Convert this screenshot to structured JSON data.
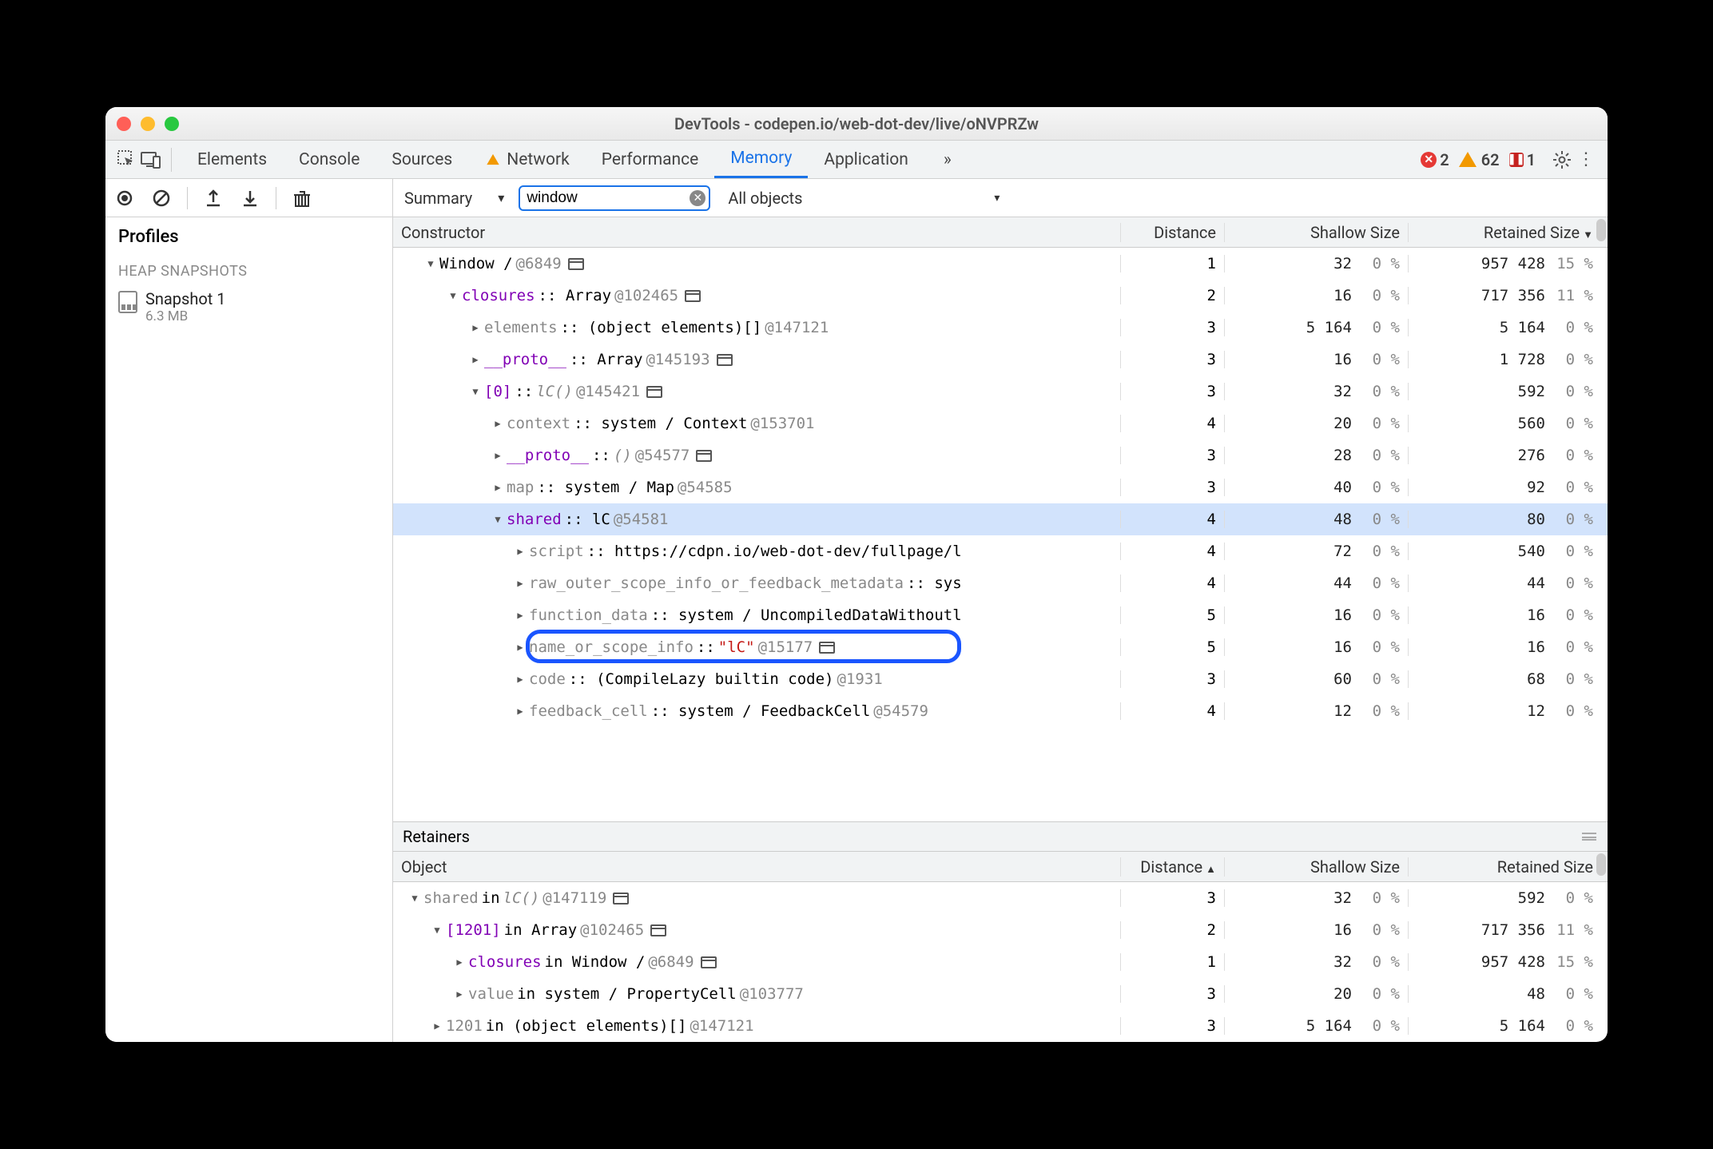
{
  "window": {
    "title": "DevTools - codepen.io/web-dot-dev/live/oNVPRZw"
  },
  "tabs": {
    "items": [
      "Elements",
      "Console",
      "Sources",
      "Network",
      "Performance",
      "Memory",
      "Application"
    ],
    "active": "Memory"
  },
  "status": {
    "errors": 2,
    "warnings": 62,
    "issues": 1
  },
  "subbar": {
    "view": "Summary",
    "filter": "window",
    "scope": "All objects"
  },
  "sidebar": {
    "title": "Profiles",
    "section": "HEAP SNAPSHOTS",
    "items": [
      {
        "name": "Snapshot 1",
        "size": "6.3 MB"
      }
    ]
  },
  "columns": {
    "constructor": "Constructor",
    "distance": "Distance",
    "shallow": "Shallow Size",
    "retained": "Retained Size"
  },
  "rows": [
    {
      "indent": 0,
      "tw": "▼",
      "parts": [
        [
          "",
          "Window / "
        ],
        [
          "grey",
          "   @6849 "
        ]
      ],
      "win": true,
      "d": "1",
      "sv": "32",
      "sp": "0 %",
      "rv": "957 428",
      "rp": "15 %"
    },
    {
      "indent": 1,
      "tw": "▼",
      "parts": [
        [
          "purple",
          "closures"
        ],
        [
          "",
          " :: Array "
        ],
        [
          "grey",
          "@102465 "
        ]
      ],
      "win": true,
      "d": "2",
      "sv": "16",
      "sp": "0 %",
      "rv": "717 356",
      "rp": "11 %"
    },
    {
      "indent": 2,
      "tw": "▶",
      "parts": [
        [
          "grey",
          "elements"
        ],
        [
          "",
          " :: (object elements)[] "
        ],
        [
          "grey",
          "@147121"
        ]
      ],
      "d": "3",
      "sv": "5 164",
      "sp": "0 %",
      "rv": "5 164",
      "rp": "0 %"
    },
    {
      "indent": 2,
      "tw": "▶",
      "parts": [
        [
          "purple",
          "__proto__"
        ],
        [
          "",
          " :: Array "
        ],
        [
          "grey",
          "@145193 "
        ]
      ],
      "win": true,
      "d": "3",
      "sv": "16",
      "sp": "0 %",
      "rv": "1 728",
      "rp": "0 %"
    },
    {
      "indent": 2,
      "tw": "▼",
      "parts": [
        [
          "purple",
          "[0]"
        ],
        [
          "",
          " :: "
        ],
        [
          "gitalic",
          "lC()"
        ],
        [
          "grey",
          " @145421 "
        ]
      ],
      "win": true,
      "d": "3",
      "sv": "32",
      "sp": "0 %",
      "rv": "592",
      "rp": "0 %"
    },
    {
      "indent": 3,
      "tw": "▶",
      "parts": [
        [
          "grey",
          "context"
        ],
        [
          "",
          " :: system / Context "
        ],
        [
          "grey",
          "@153701"
        ]
      ],
      "d": "4",
      "sv": "20",
      "sp": "0 %",
      "rv": "560",
      "rp": "0 %"
    },
    {
      "indent": 3,
      "tw": "▶",
      "parts": [
        [
          "purple",
          "__proto__"
        ],
        [
          "",
          " :: "
        ],
        [
          "gitalic",
          "()"
        ],
        [
          "grey",
          " @54577 "
        ]
      ],
      "win": true,
      "d": "3",
      "sv": "28",
      "sp": "0 %",
      "rv": "276",
      "rp": "0 %"
    },
    {
      "indent": 3,
      "tw": "▶",
      "parts": [
        [
          "grey",
          "map"
        ],
        [
          "",
          " :: system / Map "
        ],
        [
          "grey",
          "@54585"
        ]
      ],
      "d": "3",
      "sv": "40",
      "sp": "0 %",
      "rv": "92",
      "rp": "0 %"
    },
    {
      "indent": 3,
      "tw": "▼",
      "sel": true,
      "parts": [
        [
          "purple",
          "shared"
        ],
        [
          "",
          " :: lC "
        ],
        [
          "grey",
          "@54581"
        ]
      ],
      "d": "4",
      "sv": "48",
      "sp": "0 %",
      "rv": "80",
      "rp": "0 %"
    },
    {
      "indent": 4,
      "tw": "▶",
      "parts": [
        [
          "grey",
          "script"
        ],
        [
          "",
          " :: https://cdpn.io/web-dot-dev/fullpage/l"
        ]
      ],
      "d": "4",
      "sv": "72",
      "sp": "0 %",
      "rv": "540",
      "rp": "0 %"
    },
    {
      "indent": 4,
      "tw": "▶",
      "parts": [
        [
          "grey",
          "raw_outer_scope_info_or_feedback_metadata"
        ],
        [
          "",
          " :: sys"
        ]
      ],
      "d": "4",
      "sv": "44",
      "sp": "0 %",
      "rv": "44",
      "rp": "0 %"
    },
    {
      "indent": 4,
      "tw": "▶",
      "parts": [
        [
          "grey",
          "function_data"
        ],
        [
          "",
          " :: system / UncompiledDataWithoutl"
        ]
      ],
      "d": "5",
      "sv": "16",
      "sp": "0 %",
      "rv": "16",
      "rp": "0 %"
    },
    {
      "indent": 4,
      "tw": "▶",
      "ring": true,
      "parts": [
        [
          "grey",
          "name_or_scope_info"
        ],
        [
          "",
          " :: "
        ],
        [
          "red",
          "\"lC\""
        ],
        [
          "grey",
          " @15177 "
        ]
      ],
      "win": true,
      "d": "5",
      "sv": "16",
      "sp": "0 %",
      "rv": "16",
      "rp": "0 %"
    },
    {
      "indent": 4,
      "tw": "▶",
      "parts": [
        [
          "grey",
          "code"
        ],
        [
          "",
          " :: (CompileLazy builtin code) "
        ],
        [
          "grey",
          "@1931"
        ]
      ],
      "d": "3",
      "sv": "60",
      "sp": "0 %",
      "rv": "68",
      "rp": "0 %"
    },
    {
      "indent": 4,
      "tw": "▶",
      "parts": [
        [
          "grey",
          "feedback_cell"
        ],
        [
          "",
          " :: system / FeedbackCell "
        ],
        [
          "grey",
          "@54579"
        ]
      ],
      "d": "4",
      "sv": "12",
      "sp": "0 %",
      "rv": "12",
      "rp": "0 %"
    }
  ],
  "retainers": {
    "title": "Retainers",
    "columns": {
      "object": "Object",
      "distance": "Distance",
      "shallow": "Shallow Size",
      "retained": "Retained Size"
    },
    "rows": [
      {
        "indent": 0,
        "tw": "▼",
        "parts": [
          [
            "grey",
            "shared"
          ],
          [
            "",
            " in "
          ],
          [
            "gitalic",
            "lC()"
          ],
          [
            "grey",
            " @147119 "
          ]
        ],
        "win": true,
        "d": "3",
        "sv": "32",
        "sp": "0 %",
        "rv": "592",
        "rp": "0 %"
      },
      {
        "indent": 1,
        "tw": "▼",
        "parts": [
          [
            "purple",
            "[1201]"
          ],
          [
            "",
            " in Array "
          ],
          [
            "grey",
            "@102465 "
          ]
        ],
        "win": true,
        "d": "2",
        "sv": "16",
        "sp": "0 %",
        "rv": "717 356",
        "rp": "11 %"
      },
      {
        "indent": 2,
        "tw": "▶",
        "parts": [
          [
            "purple",
            "closures"
          ],
          [
            "",
            " in Window /   "
          ],
          [
            "grey",
            "@6849 "
          ]
        ],
        "win": true,
        "d": "1",
        "sv": "32",
        "sp": "0 %",
        "rv": "957 428",
        "rp": "15 %"
      },
      {
        "indent": 2,
        "tw": "▶",
        "parts": [
          [
            "grey",
            "value"
          ],
          [
            "",
            " in system / PropertyCell "
          ],
          [
            "grey",
            "@103777"
          ]
        ],
        "d": "3",
        "sv": "20",
        "sp": "0 %",
        "rv": "48",
        "rp": "0 %"
      },
      {
        "indent": 1,
        "tw": "▶",
        "parts": [
          [
            "grey",
            "1201"
          ],
          [
            "",
            " in (object elements)[] "
          ],
          [
            "grey",
            "@147121"
          ]
        ],
        "d": "3",
        "sv": "5 164",
        "sp": "0 %",
        "rv": "5 164",
        "rp": "0 %"
      }
    ]
  }
}
